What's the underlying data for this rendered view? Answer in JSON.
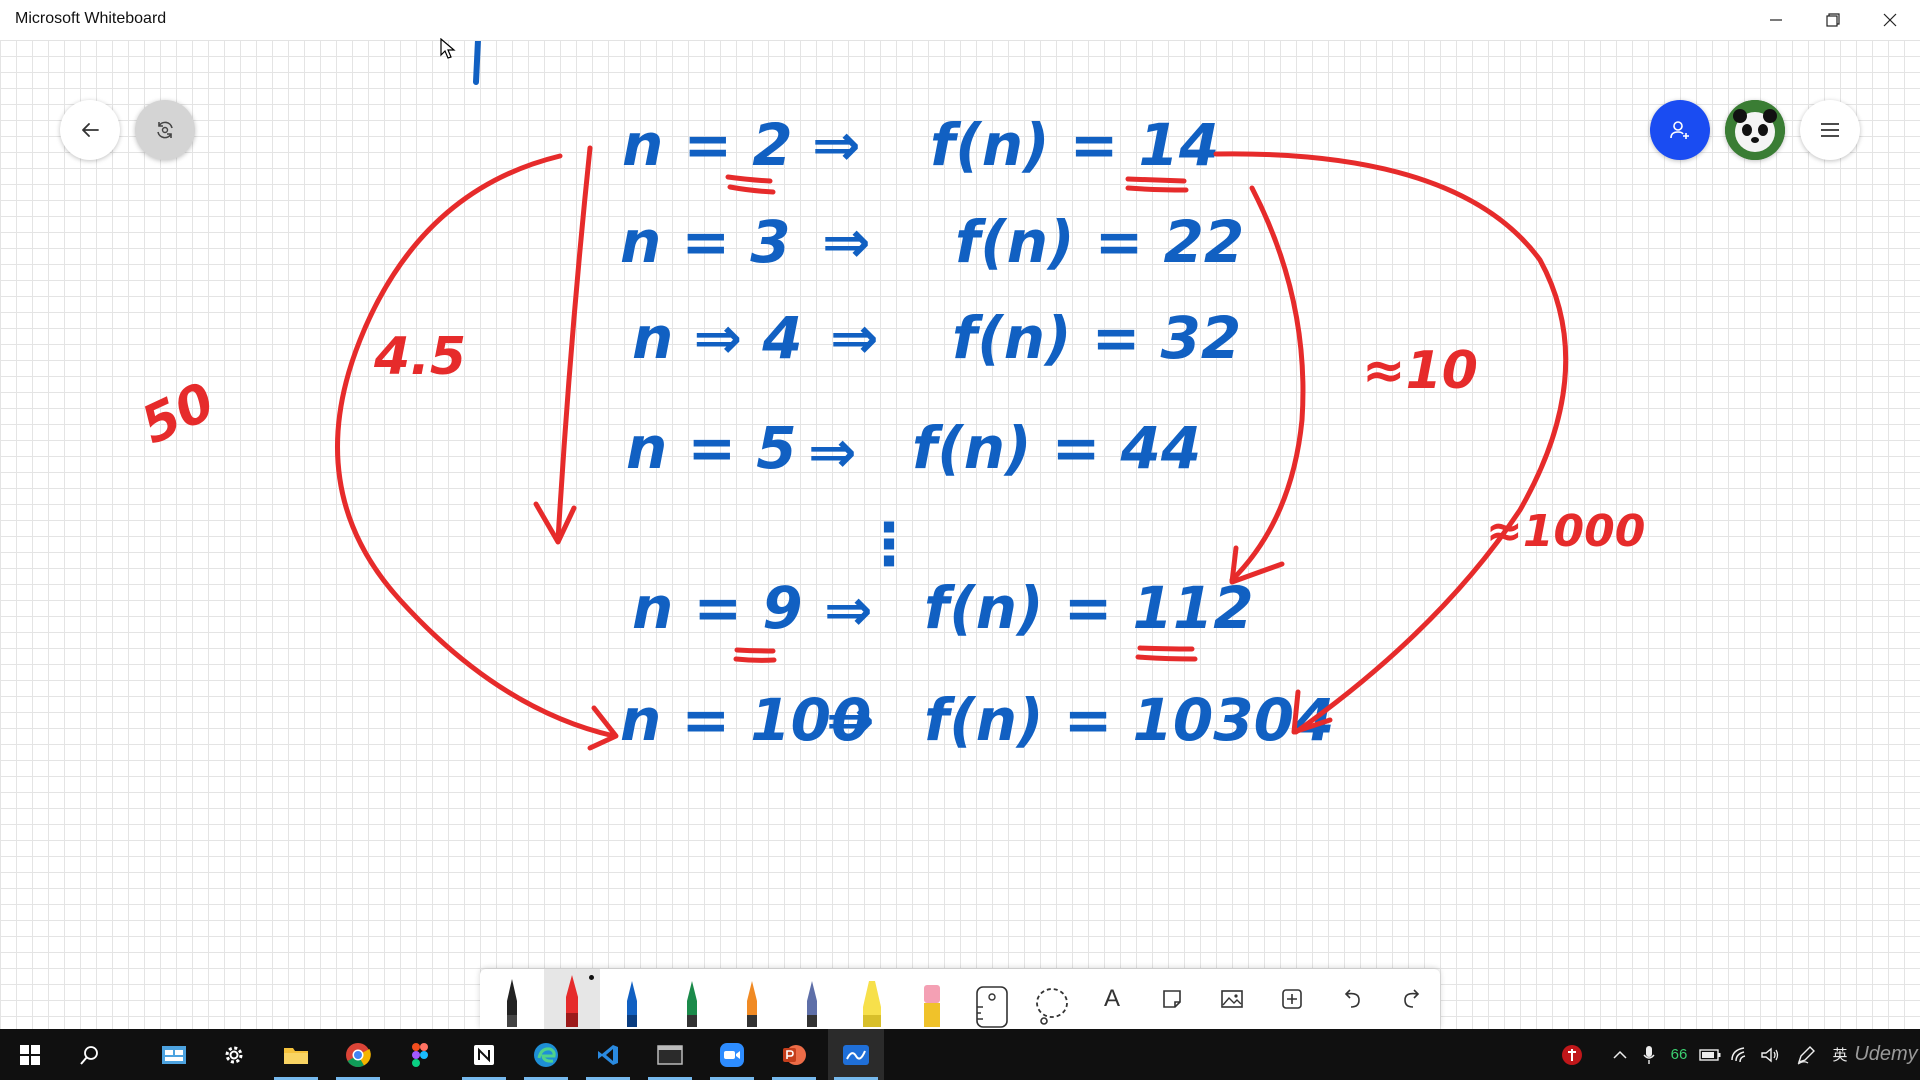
{
  "window": {
    "title": "Microsoft Whiteboard"
  },
  "canvas": {
    "blue_ink_rows": [
      {
        "n": "n = 2",
        "arrow": "⇒",
        "f": "f(n) = 14"
      },
      {
        "n": "n = 3",
        "arrow": "⇒",
        "f": "f(n) = 22"
      },
      {
        "n": "n ⇒ 4",
        "arrow": "⇒",
        "f": "f(n) = 32"
      },
      {
        "n": "n = 5",
        "arrow": "⇒",
        "f": "f(n) = 44"
      },
      {
        "n": "⋮",
        "arrow": "",
        "f": ""
      },
      {
        "n": "n = 9",
        "arrow": "⇒",
        "f": "f(n) = 112"
      },
      {
        "n": "n = 100",
        "arrow": "⇒",
        "f": "f(n) = 10304"
      }
    ],
    "red_annotations": {
      "left_ratio": "4.5",
      "left_far": "50",
      "right_ratio": "≈10",
      "right_far": "≈1000"
    },
    "colors": {
      "blue_ink": "#1160c2",
      "red_ink": "#e62b2b",
      "grid": "#e4e4e4",
      "invite_button": "#1a4cf2"
    }
  },
  "controls": {
    "back": "arrow-left-icon",
    "sync": "sync-icon",
    "invite": "add-person-icon",
    "avatar": "panda-avatar",
    "menu": "hamburger-icon"
  },
  "toolbar": {
    "tools": [
      "black-pen",
      "red-pen",
      "blue-pen",
      "green-pen",
      "rainbow-pen",
      "galaxy-pen",
      "highlighter",
      "eraser",
      "ruler",
      "lasso",
      "text",
      "sticky-note",
      "image",
      "add",
      "undo",
      "redo"
    ],
    "selected": "red-pen",
    "text_tool_label": "A"
  },
  "taskbar": {
    "apps": [
      "start",
      "search",
      "task-view",
      "settings",
      "file-explorer",
      "chrome",
      "figma",
      "notion",
      "edge",
      "vs-code",
      "terminal",
      "zoom",
      "powerpoint",
      "whiteboard"
    ],
    "tray": {
      "battery_percent": "66",
      "ime": "英",
      "watermark": "Udemy"
    }
  }
}
